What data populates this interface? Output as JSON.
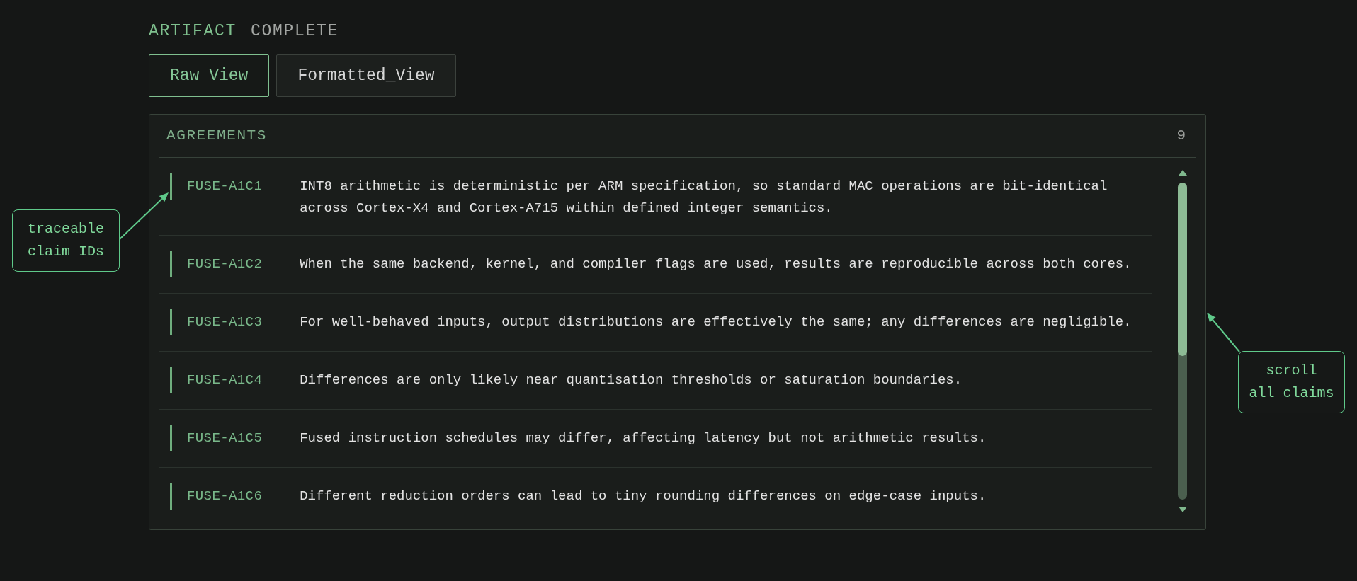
{
  "header": {
    "title": "ARTIFACT",
    "status": "COMPLETE"
  },
  "tabs": [
    {
      "label": "Raw View",
      "selected": true
    },
    {
      "label": "Formatted_View",
      "selected": false
    }
  ],
  "panel": {
    "title": "AGREEMENTS",
    "count": "9",
    "claims": [
      {
        "id": "FUSE-A1C1",
        "text": "INT8 arithmetic is deterministic per ARM specification, so standard MAC operations are bit-identical across Cortex-X4 and Cortex-A715 within defined integer semantics."
      },
      {
        "id": "FUSE-A1C2",
        "text": "When the same backend, kernel, and compiler flags are used, results are reproducible across both cores."
      },
      {
        "id": "FUSE-A1C3",
        "text": "For well-behaved inputs, output distributions are effectively the same; any differences are negligible."
      },
      {
        "id": "FUSE-A1C4",
        "text": "Differences are only likely near quantisation thresholds or saturation boundaries."
      },
      {
        "id": "FUSE-A1C5",
        "text": "Fused instruction schedules may differ, affecting latency but not arithmetic results."
      },
      {
        "id": "FUSE-A1C6",
        "text": "Different reduction orders can lead to tiny rounding differences on edge-case inputs."
      }
    ]
  },
  "callouts": [
    {
      "lines": [
        "traceable",
        "claim IDs"
      ]
    },
    {
      "lines": [
        "scroll",
        "all claims"
      ]
    }
  ]
}
